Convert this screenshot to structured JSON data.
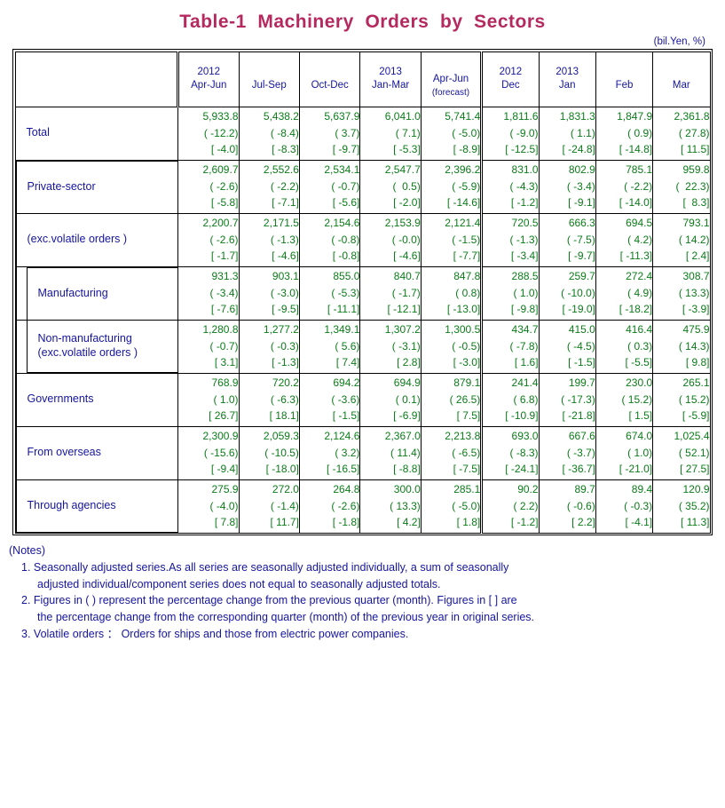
{
  "title": "Table-1  Machinery  Orders  by  Sectors",
  "unit": "(bil.Yen, %)",
  "header": {
    "blank": "",
    "columns": [
      {
        "year": "2012",
        "period": "Apr-Jun",
        "sub": ""
      },
      {
        "year": "",
        "period": "Jul-Sep",
        "sub": ""
      },
      {
        "year": "",
        "period": "Oct-Dec",
        "sub": ""
      },
      {
        "year": "2013",
        "period": "Jan-Mar",
        "sub": ""
      },
      {
        "year": "",
        "period": "Apr-Jun",
        "sub": "(forecast)"
      },
      {
        "year": "2012",
        "period": "Dec",
        "sub": ""
      },
      {
        "year": "2013",
        "period": "Jan",
        "sub": ""
      },
      {
        "year": "",
        "period": "Feb",
        "sub": ""
      },
      {
        "year": "",
        "period": "Mar",
        "sub": ""
      }
    ]
  },
  "chart_data": {
    "type": "table",
    "title": "Table-1  Machinery  Orders  by  Sectors",
    "unit": "(bil.Yen, %)",
    "column_headers": [
      "",
      "2012 Apr-Jun",
      "2012 Jul-Sep",
      "2012 Oct-Dec",
      "2013 Jan-Mar",
      "2013 Apr-Jun (forecast)",
      "2012 Dec",
      "2013 Jan",
      "2013 Feb",
      "2013 Mar"
    ],
    "row_format": [
      "level",
      "(quarter/month-on-quarter/month % change)",
      "[year-on-year % change]"
    ],
    "rows": [
      {
        "label": "Total",
        "indent": 0,
        "level": [
          "5,933.8",
          "5,438.2",
          "5,637.9",
          "6,041.0",
          "5,741.4",
          "1,811.6",
          "1,831.3",
          "1,847.9",
          "2,361.8"
        ],
        "qoq": [
          "( -12.2)",
          "( -8.4)",
          "( 3.7)",
          "( 7.1)",
          "( -5.0)",
          "( -9.0)",
          "( 1.1)",
          "( 0.9)",
          "( 27.8)"
        ],
        "yoy": [
          "[ -4.0]",
          "[ -8.3]",
          "[ -9.7]",
          "[ -5.3]",
          "[ -8.9]",
          "[ -12.5]",
          "[ -24.8]",
          "[ -14.8]",
          "[ 11.5]"
        ]
      },
      {
        "label": "Private-sector",
        "indent": 1,
        "level": [
          "2,609.7",
          "2,552.6",
          "2,534.1",
          "2,547.7",
          "2,396.2",
          "831.0",
          "802.9",
          "785.1",
          "959.8"
        ],
        "qoq": [
          "( -2.6)",
          "( -2.2)",
          "( -0.7)",
          "(  0.5)",
          "( -5.9)",
          "( -4.3)",
          "( -3.4)",
          "( -2.2)",
          "(  22.3)"
        ],
        "yoy": [
          "[ -5.8]",
          "[ -7.1]",
          "[ -5.6]",
          "[ -2.0]",
          "[ -14.6]",
          "[ -1.2]",
          "[ -9.1]",
          "[ -14.0]",
          "[  8.3]"
        ]
      },
      {
        "label": "(exc.volatile orders )",
        "indent": 1,
        "level": [
          "2,200.7",
          "2,171.5",
          "2,154.6",
          "2,153.9",
          "2,121.4",
          "720.5",
          "666.3",
          "694.5",
          "793.1"
        ],
        "qoq": [
          "( -2.6)",
          "( -1.3)",
          "( -0.8)",
          "( -0.0)",
          "( -1.5)",
          "( -1.3)",
          "( -7.5)",
          "( 4.2)",
          "( 14.2)"
        ],
        "yoy": [
          "[ -1.7]",
          "[ -4.6]",
          "[ -0.8]",
          "[ -4.6]",
          "[ -7.7]",
          "[ -3.4]",
          "[ -9.7]",
          "[ -11.3]",
          "[ 2.4]"
        ]
      },
      {
        "label": "Manufacturing",
        "indent": 2,
        "level": [
          "931.3",
          "903.1",
          "855.0",
          "840.7",
          "847.8",
          "288.5",
          "259.7",
          "272.4",
          "308.7"
        ],
        "qoq": [
          "( -3.4)",
          "( -3.0)",
          "( -5.3)",
          "( -1.7)",
          "( 0.8)",
          "( 1.0)",
          "( -10.0)",
          "( 4.9)",
          "( 13.3)"
        ],
        "yoy": [
          "[ -7.6]",
          "[ -9.5]",
          "[ -11.1]",
          "[ -12.1]",
          "[ -13.0]",
          "[ -9.8]",
          "[ -19.0]",
          "[ -18.2]",
          "[ -3.9]"
        ]
      },
      {
        "label": "Non-manufacturing",
        "label2": "(exc.volatile orders )",
        "indent": 2,
        "level": [
          "1,280.8",
          "1,277.2",
          "1,349.1",
          "1,307.2",
          "1,300.5",
          "434.7",
          "415.0",
          "416.4",
          "475.9"
        ],
        "qoq": [
          "( -0.7)",
          "( -0.3)",
          "( 5.6)",
          "( -3.1)",
          "( -0.5)",
          "( -7.8)",
          "( -4.5)",
          "( 0.3)",
          "( 14.3)"
        ],
        "yoy": [
          "[ 3.1]",
          "[ -1.3]",
          "[ 7.4]",
          "[ 2.8]",
          "[ -3.0]",
          "[ 1.6]",
          "[ -1.5]",
          "[ -5.5]",
          "[ 9.8]"
        ]
      },
      {
        "label": "Governments",
        "indent": 1,
        "level": [
          "768.9",
          "720.2",
          "694.2",
          "694.9",
          "879.1",
          "241.4",
          "199.7",
          "230.0",
          "265.1"
        ],
        "qoq": [
          "( 1.0)",
          "( -6.3)",
          "( -3.6)",
          "( 0.1)",
          "( 26.5)",
          "( 6.8)",
          "( -17.3)",
          "( 15.2)",
          "( 15.2)"
        ],
        "yoy": [
          "[ 26.7]",
          "[ 18.1]",
          "[ -1.5]",
          "[ -6.9]",
          "[ 7.5]",
          "[ -10.9]",
          "[ -21.8]",
          "[ 1.5]",
          "[ -5.9]"
        ]
      },
      {
        "label": "From overseas",
        "indent": 1,
        "level": [
          "2,300.9",
          "2,059.3",
          "2,124.6",
          "2,367.0",
          "2,213.8",
          "693.0",
          "667.6",
          "674.0",
          "1,025.4"
        ],
        "qoq": [
          "( -15.6)",
          "( -10.5)",
          "( 3.2)",
          "( 11.4)",
          "( -6.5)",
          "( -8.3)",
          "( -3.7)",
          "( 1.0)",
          "( 52.1)"
        ],
        "yoy": [
          "[ -9.4]",
          "[ -18.0]",
          "[ -16.5]",
          "[ -8.8]",
          "[ -7.5]",
          "[ -24.1]",
          "[ -36.7]",
          "[ -21.0]",
          "[ 27.5]"
        ]
      },
      {
        "label": "Through agencies",
        "indent": 1,
        "level": [
          "275.9",
          "272.0",
          "264.8",
          "300.0",
          "285.1",
          "90.2",
          "89.7",
          "89.4",
          "120.9"
        ],
        "qoq": [
          "( -4.0)",
          "( -1.4)",
          "( -2.6)",
          "( 13.3)",
          "( -5.0)",
          "( 2.2)",
          "( -0.6)",
          "( -0.3)",
          "( 35.2)"
        ],
        "yoy": [
          "[ 7.8]",
          "[ 11.7]",
          "[ -1.8]",
          "[ 4.2]",
          "[ 1.8]",
          "[ -1.2]",
          "[ 2.2]",
          "[ -4.1]",
          "[ 11.3]"
        ]
      }
    ]
  },
  "notes": {
    "heading": "(Notes)",
    "items": [
      {
        "num": "1.",
        "line1": "Seasonally adjusted series.As all series are seasonally adjusted individually, a sum of seasonally",
        "line2": "adjusted individual/component series does not equal to seasonally adjusted totals."
      },
      {
        "num": "2.",
        "line1": "Figures in ( ) represent the percentage change from the previous quarter (month). Figures in [ ] are",
        "line2": "the percentage change from the corresponding quarter (month) of the previous year in original series."
      },
      {
        "num": "3.",
        "line1": "Volatile orders ： Orders for ships and those from electric power companies.",
        "line2": ""
      }
    ]
  },
  "colors": {
    "title": "#b5295f",
    "label_text": "#15159e",
    "data_text": "#0b7c19",
    "border": "#000000",
    "background": "#ffffff"
  }
}
